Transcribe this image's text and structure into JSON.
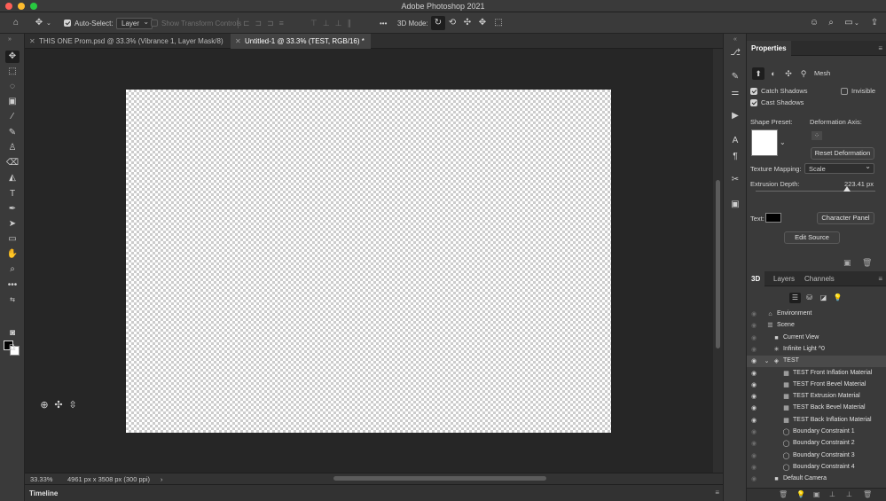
{
  "app": {
    "title": "Adobe Photoshop 2021"
  },
  "options_bar": {
    "auto_select_label": "Auto-Select:",
    "auto_select_value": "Layer",
    "show_transform_controls": "Show Transform Controls",
    "three_d_mode_label": "3D Mode:",
    "more": "•••"
  },
  "tabs": [
    {
      "label": "THIS ONE Prom.psd @ 33.3% (Vibrance 1, Layer Mask/8)",
      "active": false
    },
    {
      "label": "Untitled-1 @ 33.3% (TEST, RGB/16) *",
      "active": true
    }
  ],
  "status": {
    "zoom": "33.33%",
    "doc_info": "4961 px x 3508 px (300 ppi)",
    "arrow": "›"
  },
  "timeline": {
    "label": "Timeline"
  },
  "properties": {
    "title": "Properties",
    "mesh_label": "Mesh",
    "catch_shadows": "Catch Shadows",
    "invisible": "Invisible",
    "cast_shadows": "Cast Shadows",
    "shape_preset": "Shape Preset:",
    "deformation_axis": "Deformation Axis:",
    "reset_deformation": "Reset Deformation",
    "texture_mapping_label": "Texture Mapping:",
    "texture_mapping_value": "Scale",
    "extrusion_depth_label": "Extrusion Depth:",
    "extrusion_depth_value": "223.41 px",
    "extrusion_depth_level": 0.76,
    "text_label": "Text:",
    "character_panel": "Character Panel",
    "edit_source": "Edit Source"
  },
  "layers_panel": {
    "tabs": [
      "3D",
      "Layers",
      "Channels"
    ],
    "rows": [
      {
        "name": "Environment",
        "visible": false,
        "icon": "environment-icon",
        "glyph": "⌂"
      },
      {
        "name": "Scene",
        "visible": false,
        "icon": "scene-icon",
        "glyph": "☰"
      },
      {
        "name": "Current View",
        "visible": false,
        "icon": "camera-icon",
        "glyph": "■"
      },
      {
        "name": "Infinite Light ^0",
        "visible": false,
        "icon": "light-icon",
        "glyph": "✳"
      },
      {
        "name": "TEST",
        "visible": true,
        "icon": "mesh-icon",
        "glyph": "◈",
        "selected": true
      },
      {
        "name": "TEST Front Inflation Material",
        "visible": true,
        "icon": "material-icon",
        "glyph": "▦"
      },
      {
        "name": "TEST Front Bevel Material",
        "visible": true,
        "icon": "material-icon",
        "glyph": "▦"
      },
      {
        "name": "TEST Extrusion Material",
        "visible": true,
        "icon": "material-icon",
        "glyph": "▦"
      },
      {
        "name": "TEST Back Bevel Material",
        "visible": true,
        "icon": "material-icon",
        "glyph": "▦"
      },
      {
        "name": "TEST Back Inflation Material",
        "visible": true,
        "icon": "material-icon",
        "glyph": "▦"
      },
      {
        "name": "Boundary Constraint 1",
        "visible": false,
        "icon": "constraint-icon",
        "glyph": "◯"
      },
      {
        "name": "Boundary Constraint 2",
        "visible": false,
        "icon": "constraint-icon",
        "glyph": "◯"
      },
      {
        "name": "Boundary Constraint 3",
        "visible": false,
        "icon": "constraint-icon",
        "glyph": "◯"
      },
      {
        "name": "Boundary Constraint 4",
        "visible": false,
        "icon": "constraint-icon",
        "glyph": "◯"
      },
      {
        "name": "Default Camera",
        "visible": false,
        "icon": "camera-icon",
        "glyph": "■"
      }
    ]
  }
}
